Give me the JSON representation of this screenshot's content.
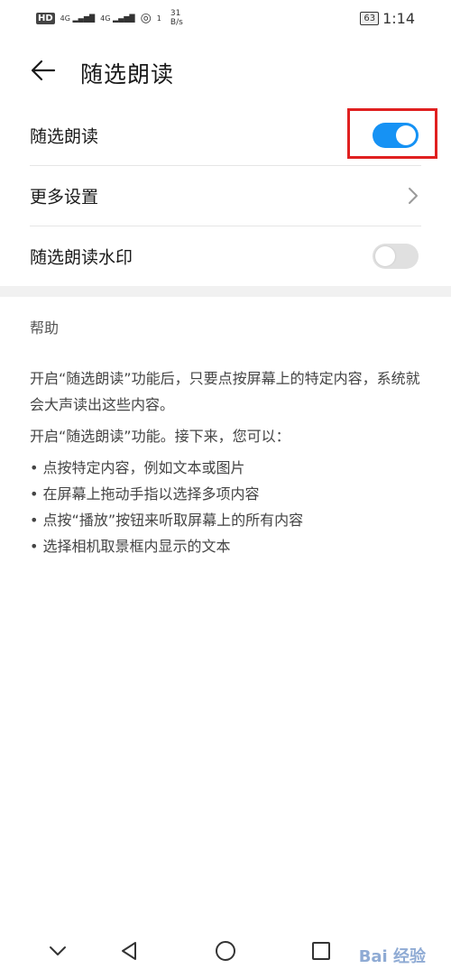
{
  "status_bar": {
    "left_badge": "HD",
    "network1": "4G",
    "network2": "4G",
    "speed_value": "31",
    "speed_unit": "B/s",
    "wifi_num": "1",
    "battery": "63",
    "time": "1:14"
  },
  "header": {
    "title": "随选朗读"
  },
  "settings": [
    {
      "label": "随选朗读",
      "control": "toggle",
      "on": true
    },
    {
      "label": "更多设置",
      "control": "chevron"
    },
    {
      "label": "随选朗读水印",
      "control": "toggle",
      "on": false
    }
  ],
  "help": {
    "title": "帮助",
    "paragraph1": "开启“随选朗读”功能后，只要点按屏幕上的特定内容，系统就会大声读出这些内容。",
    "paragraph2": "开启“随选朗读”功能。接下来，您可以：",
    "bullets": [
      "点按特定内容，例如文本或图片",
      "在屏幕上拖动手指以选择多项内容",
      "点按“播放”按钮来听取屏幕上的所有内容",
      "选择相机取景框内显示的文本"
    ]
  },
  "watermark_text": "Bai 经验",
  "colors": {
    "accent": "#1692f4",
    "highlight": "#e02020"
  },
  "icons": [
    "back-arrow-icon",
    "chevron-right-icon",
    "nav-down-icon",
    "nav-back-icon",
    "nav-home-icon",
    "nav-recents-icon"
  ]
}
